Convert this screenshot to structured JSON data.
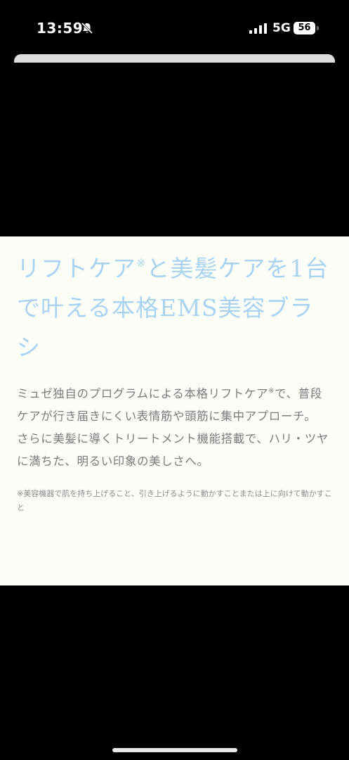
{
  "status_bar": {
    "time": "13:59",
    "network": "5G",
    "battery": "56",
    "silent_icon": "bell-slash-icon",
    "signal_icon": "signal-bars-icon"
  },
  "article": {
    "headline_part1": "リフトケア",
    "headline_mark": "※",
    "headline_part2": "と美髪ケアを1台で叶える本格EMS美容ブラシ",
    "paragraph1_part1": "ミュゼ独自のプログラムによる本格リフトケア",
    "paragraph1_mark": "※",
    "paragraph1_part2": "で、普段ケアが行き届きにくい表情筋や頭筋に集中アプローチ。",
    "paragraph2": "さらに美髪に導くトリートメント機能搭載で、ハリ・ツヤに満ちた、明るい印象の美しさへ。",
    "footnote": "※美容機器で肌を持ち上げること、引き上げるように動かすことまたは上に向けて動かすこと"
  },
  "colors": {
    "headline": "#a9d3ee",
    "card_background": "#fdfdf7",
    "body_text": "#7c7c7c"
  }
}
